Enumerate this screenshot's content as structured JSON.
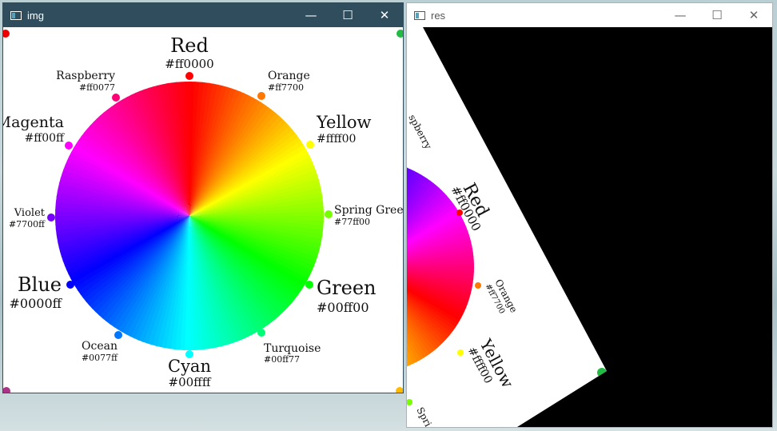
{
  "windows": {
    "img": {
      "title": "img"
    },
    "res": {
      "title": "res"
    }
  },
  "controls": {
    "minimize_glyph": "—",
    "maximize_glyph": "☐",
    "close_glyph": "✕"
  },
  "wheel": {
    "labels": {
      "red": {
        "name": "Red",
        "hex": "#ff0000",
        "color": "#ff0000"
      },
      "orange": {
        "name": "Orange",
        "hex": "#ff7700",
        "color": "#ff7700"
      },
      "yellow": {
        "name": "Yellow",
        "hex": "#ffff00",
        "color": "#ffff00"
      },
      "springgreen": {
        "name": "Spring Green",
        "hex": "#77ff00",
        "color": "#77ff00"
      },
      "green": {
        "name": "Green",
        "hex": "#00ff00",
        "color": "#00ff00"
      },
      "turquoise": {
        "name": "Turquoise",
        "hex": "#00ff77",
        "color": "#00ff77"
      },
      "cyan": {
        "name": "Cyan",
        "hex": "#00ffff",
        "color": "#00ffff"
      },
      "ocean": {
        "name": "Ocean",
        "hex": "#0077ff",
        "color": "#0077ff"
      },
      "blue": {
        "name": "Blue",
        "hex": "#0000ff",
        "color": "#0000ff"
      },
      "violet": {
        "name": "Violet",
        "hex": "#7700ff",
        "color": "#7700ff"
      },
      "magenta": {
        "name": "Magenta",
        "hex": "#ff00ff",
        "color": "#ff00ff"
      },
      "raspberry": {
        "name": "Raspberry",
        "hex": "#ff0077",
        "color": "#ff0077"
      }
    }
  },
  "res_view": {
    "partial_label_raspberry": "spberry",
    "partial_label_spring": "Spri"
  }
}
